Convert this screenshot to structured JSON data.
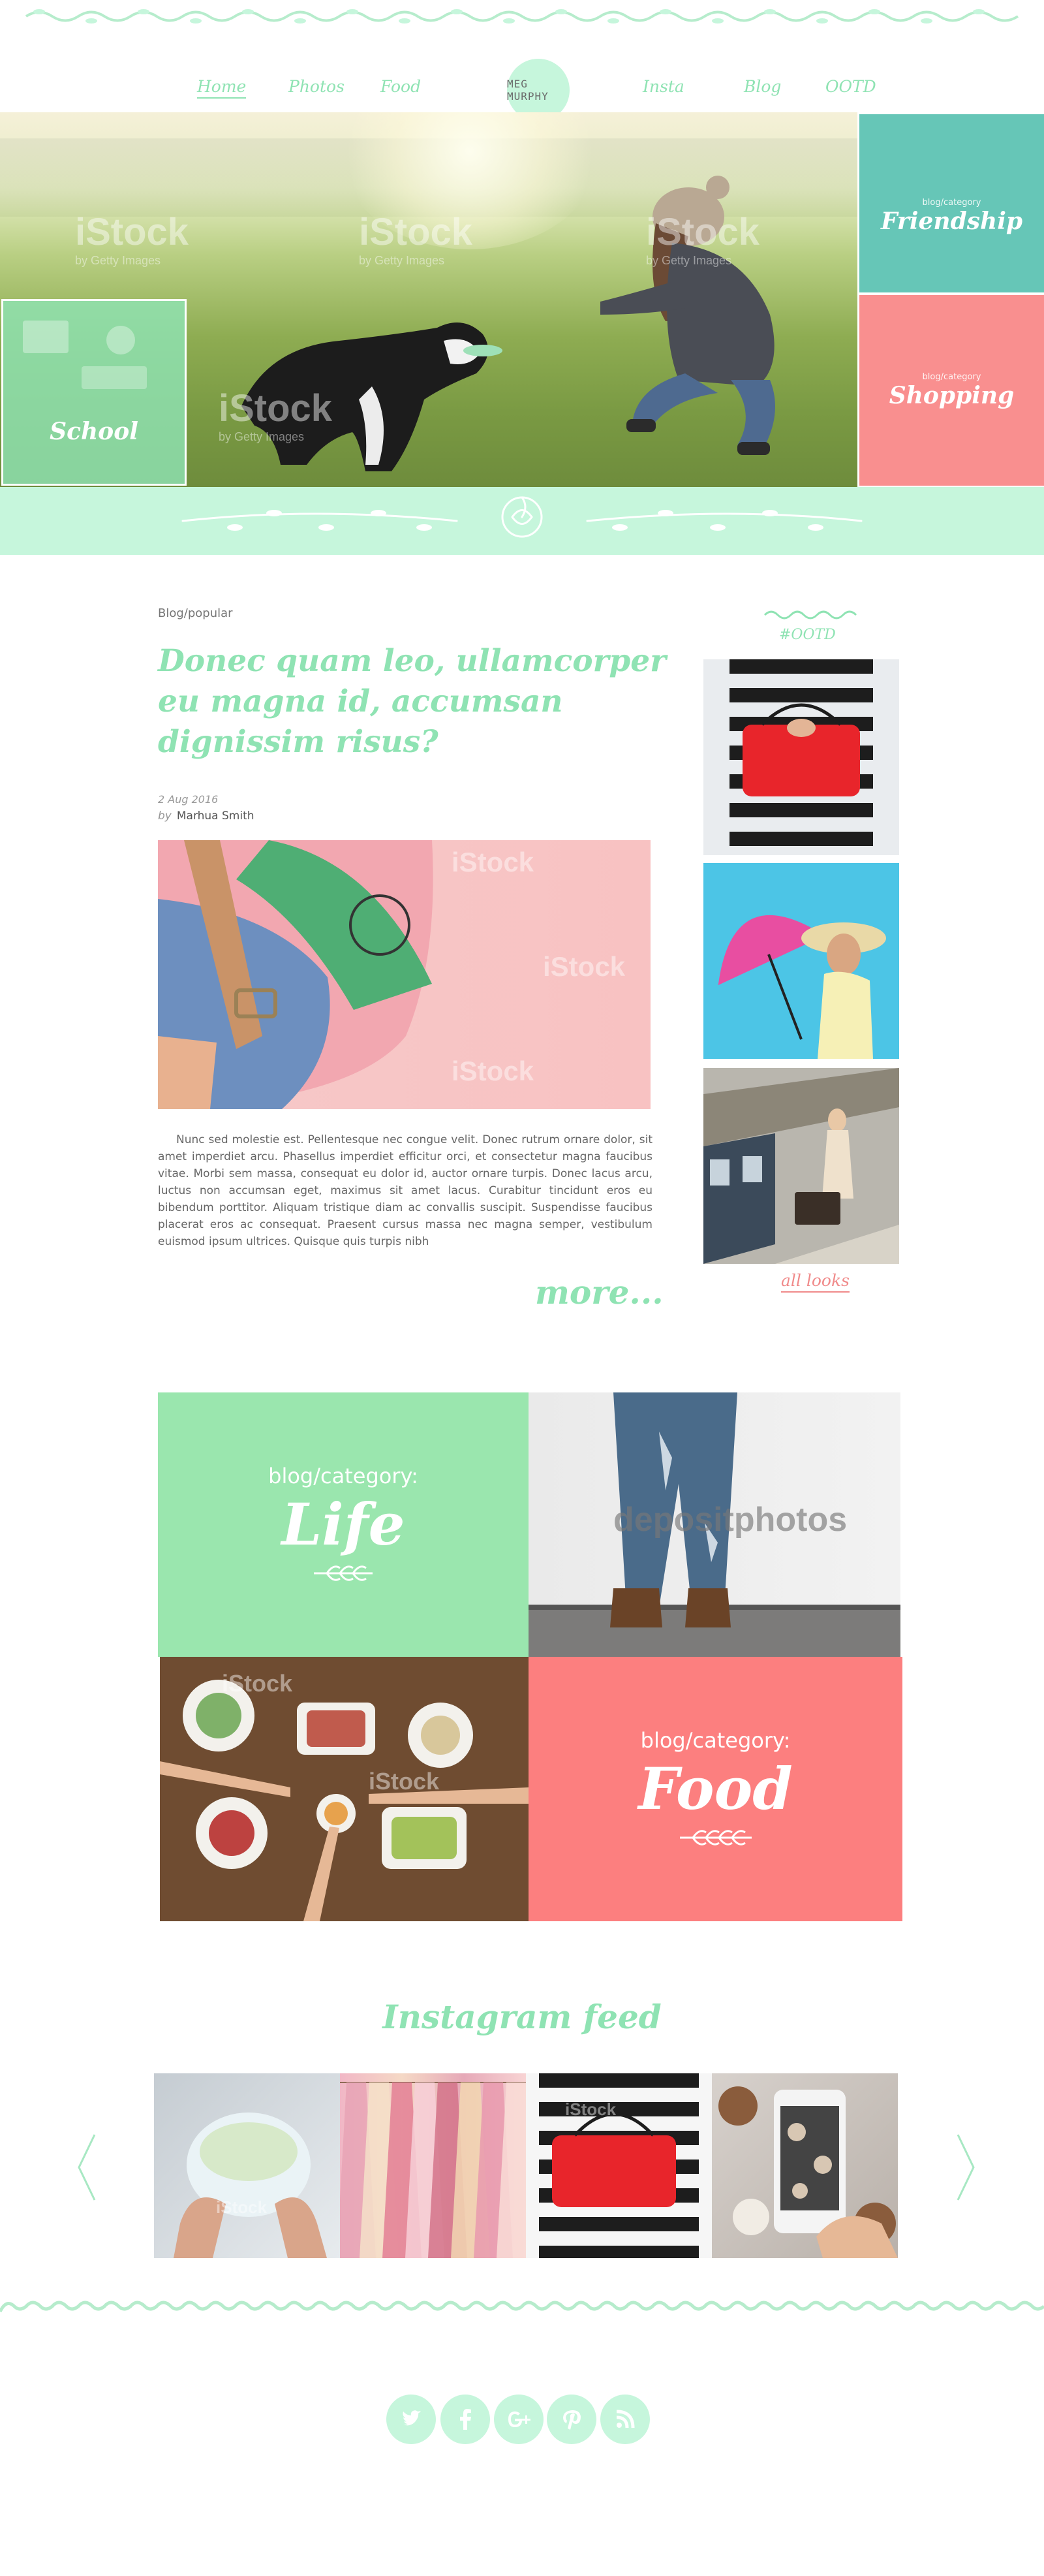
{
  "nav": {
    "left": [
      "Home",
      "Photos",
      "Food"
    ],
    "right": [
      "Insta",
      "Blog",
      "OOTD"
    ],
    "logo": "MEG MURPHY"
  },
  "hero": {
    "tiles": [
      {
        "category": "",
        "title": "School"
      },
      {
        "category": "blog/category",
        "title": "Friendship"
      },
      {
        "category": "blog/category",
        "title": "Shopping"
      }
    ],
    "watermark": "iStock",
    "watermark_sub": "by Getty Images"
  },
  "article": {
    "breadcrumb": "Blog/popular",
    "title": "Donec quam leo, ullamcorper eu magna id, accumsan dignissim risus?",
    "date": "2 Aug 2016",
    "by": "by",
    "author": "Marhua Smith",
    "image_watermark": "iStock",
    "body": "Nunc sed molestie est. Pellentesque nec congue velit. Donec rutrum ornare dolor, sit amet imperdiet arcu. Phasellus imperdiet efficitur orci, et consectetur magna faucibus vitae. Morbi sem massa, consequat eu dolor id, auctor ornare turpis. Donec lacus arcu, luctus non accumsan eget, maximus sit amet lacus. Curabitur tincidunt eros eu bibendum porttitor. Aliquam tristique diam ac convallis suscipit. Suspendisse faucibus placerat eros ac consequat. Praesent cursus massa nec magna semper, vestibulum euismod ipsum ultrices. Quisque quis turpis nibh",
    "more": "more..."
  },
  "sidebar": {
    "label": "#OOTD",
    "all_looks": "all looks",
    "watermark": "iStock"
  },
  "categories": {
    "life": {
      "category": "blog/category:",
      "title": "Life"
    },
    "food": {
      "category": "blog/category:",
      "title": "Food"
    },
    "jeans_watermark": "depositphotos",
    "table_watermark": "iStock"
  },
  "instagram": {
    "title": "Instagram feed",
    "watermark": "iStock"
  },
  "social": [
    "twitter-icon",
    "facebook-icon",
    "google-plus-icon",
    "pinterest-icon",
    "rss-icon"
  ],
  "colors": {
    "mint": "#8fe3b3",
    "mint_light": "#c6f6dc",
    "coral": "#fc7f7f",
    "teal": "#4bbcaa"
  }
}
